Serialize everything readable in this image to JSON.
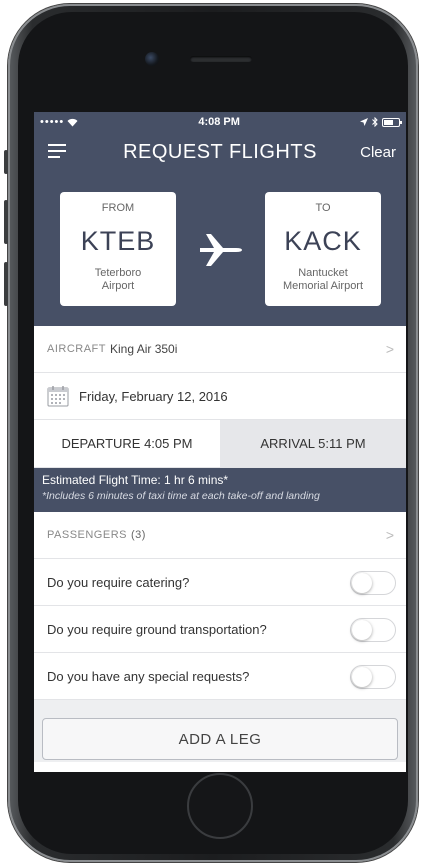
{
  "status_bar": {
    "signal": "•••••",
    "time": "4:08 PM"
  },
  "nav": {
    "title": "REQUEST FLIGHTS",
    "clear_label": "Clear"
  },
  "route": {
    "from": {
      "label": "FROM",
      "code": "KTEB",
      "name_line1": "Teterboro",
      "name_line2": "Airport"
    },
    "to": {
      "label": "TO",
      "code": "KACK",
      "name_line1": "Nantucket",
      "name_line2": "Memorial Airport"
    }
  },
  "aircraft": {
    "label": "AIRCRAFT",
    "value": "King Air 350i"
  },
  "date": {
    "value": "Friday, February 12, 2016"
  },
  "times": {
    "departure": "DEPARTURE 4:05 PM",
    "arrival": "ARRIVAL 5:11 PM"
  },
  "estimate": {
    "main": "Estimated Flight Time: 1 hr 6 mins*",
    "note": "*Includes 6 minutes of taxi time at each take-off and landing"
  },
  "passengers": {
    "label": "PASSENGERS",
    "count": "(3)"
  },
  "questions": [
    {
      "label": "Do you require catering?",
      "enabled": false
    },
    {
      "label": "Do you require ground transportation?",
      "enabled": false
    },
    {
      "label": "Do you have any special requests?",
      "enabled": false
    }
  ],
  "add_leg_label": "ADD A LEG",
  "colors": {
    "accent": "#475066",
    "arrival_bg": "#e6e7ea"
  }
}
